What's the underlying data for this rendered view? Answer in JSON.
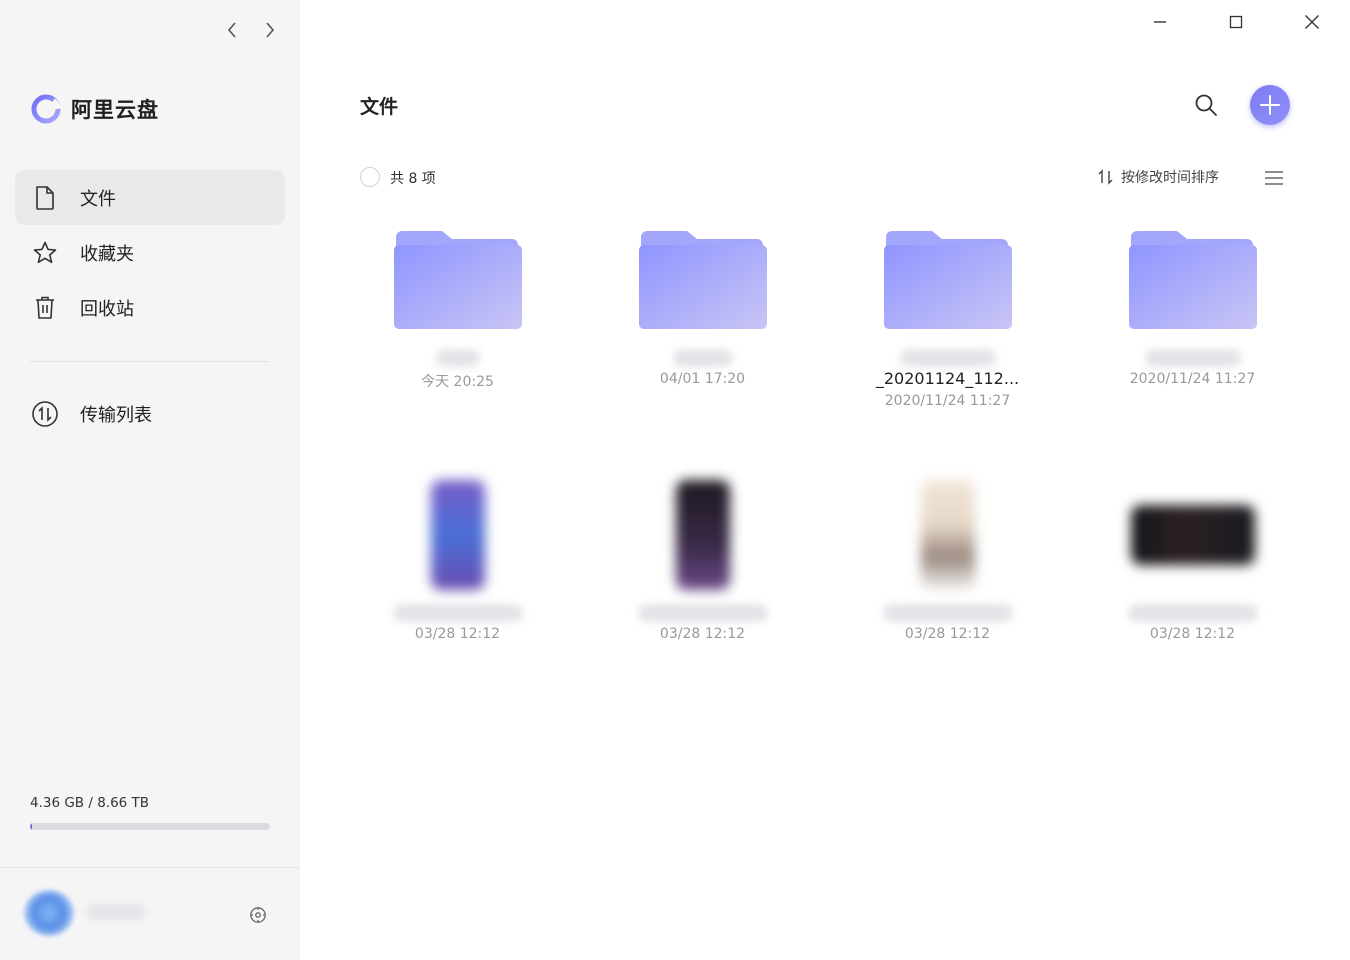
{
  "app": {
    "name": "阿里云盘",
    "accent_color": "#7c7cf2"
  },
  "sidebar": {
    "items": [
      {
        "label": "文件",
        "icon": "file-icon",
        "active": true
      },
      {
        "label": "收藏夹",
        "icon": "star-icon",
        "active": false
      },
      {
        "label": "回收站",
        "icon": "trash-icon",
        "active": false
      }
    ],
    "transfer_label": "传输列表",
    "storage": {
      "text": "4.36 GB / 8.66 TB",
      "used_fraction": 0.0005
    }
  },
  "main": {
    "title": "文件",
    "count_label": "共 8 项",
    "sort_label": "按修改时间排序"
  },
  "files": [
    {
      "type": "folder",
      "name": "",
      "time": "今天 20:25"
    },
    {
      "type": "folder",
      "name": "",
      "time": "04/01 17:20"
    },
    {
      "type": "folder",
      "name": "_20201124_112...",
      "time": "2020/11/24 11:27"
    },
    {
      "type": "folder",
      "name": "",
      "time": "2020/11/24 11:27"
    },
    {
      "type": "image",
      "name": "",
      "time": "03/28 12:12",
      "thumb_color": "#5a4fb0"
    },
    {
      "type": "image",
      "name": "",
      "time": "03/28 12:12",
      "thumb_color": "#2a2230"
    },
    {
      "type": "image",
      "name": "",
      "time": "03/28 12:12",
      "thumb_color": "#d9cfc5"
    },
    {
      "type": "image",
      "name": "",
      "time": "03/28 12:12",
      "thumb_color": "#1a1a1f"
    }
  ]
}
